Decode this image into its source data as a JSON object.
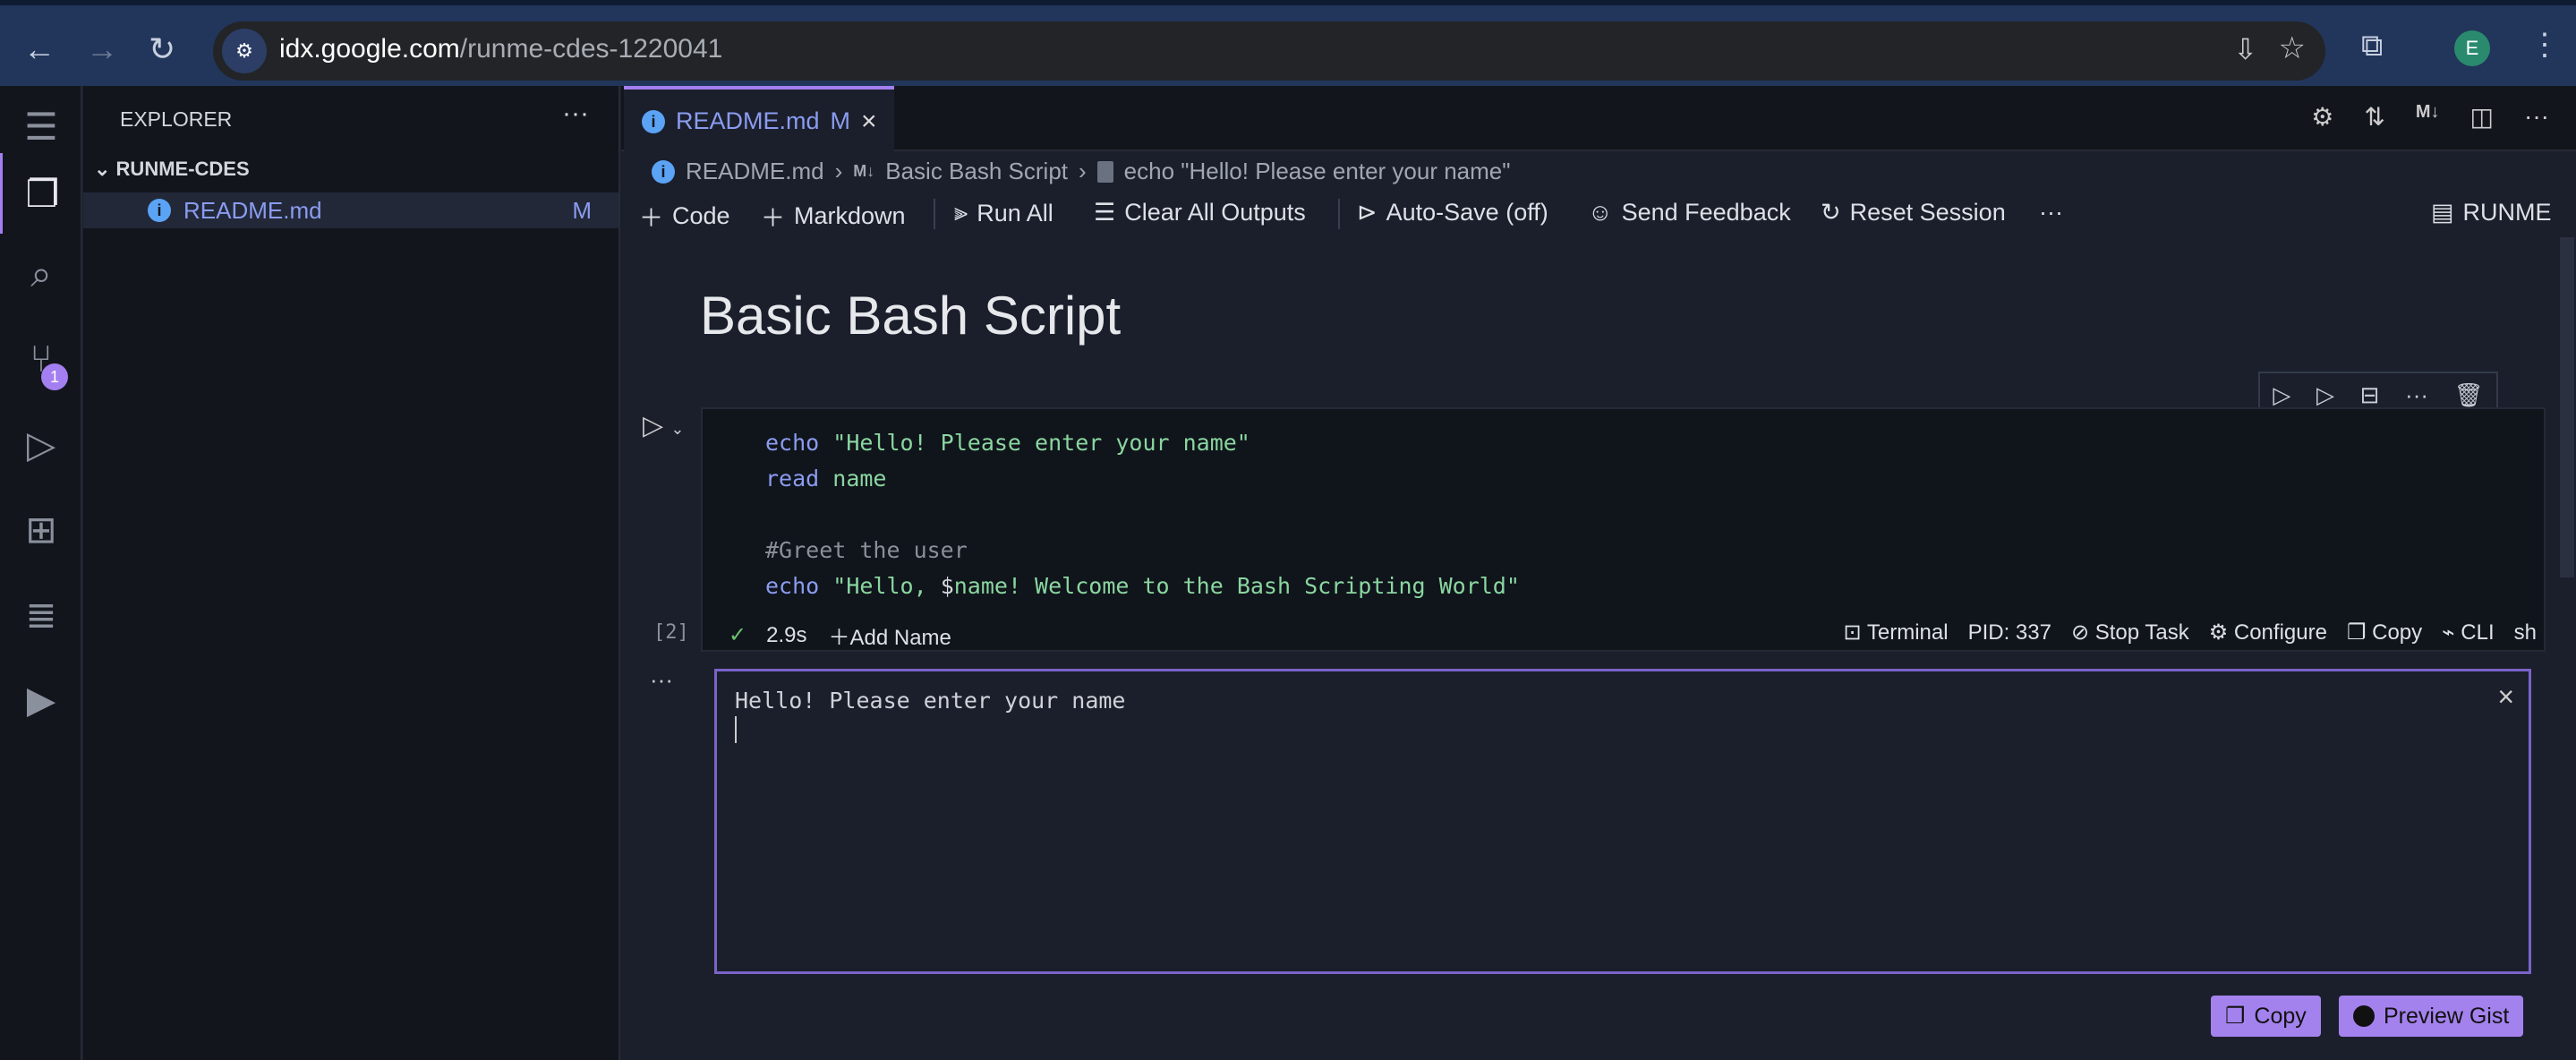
{
  "browser": {
    "url_host": "idx.google.com",
    "url_path": "/runme-cdes-1220041",
    "avatar": "E"
  },
  "sidebar": {
    "title": "EXPLORER",
    "folder": "RUNME-CDES",
    "files": [
      {
        "name": "README.md",
        "status": "M"
      }
    ]
  },
  "activity": {
    "scm_badge": "1"
  },
  "tab": {
    "label": "README.md",
    "status": "M"
  },
  "breadcrumb": [
    "README.md",
    "Basic Bash Script",
    "echo \"Hello! Please enter your name\""
  ],
  "toolbar": {
    "code": "Code",
    "markdown": "Markdown",
    "run_all": "Run All",
    "clear": "Clear All Outputs",
    "autosave": "Auto-Save (off)",
    "feedback": "Send Feedback",
    "reset": "Reset Session",
    "kernel": "RUNME"
  },
  "heading": "Basic Bash Script",
  "cell": {
    "lines": [
      [
        {
          "t": "echo",
          "c": "kw"
        },
        {
          "t": " \"Hello! Please enter your name\"",
          "c": "str"
        }
      ],
      [
        {
          "t": "read",
          "c": "kw"
        },
        {
          "t": " name",
          "c": "str"
        }
      ],
      [],
      [
        {
          "t": "#Greet the user",
          "c": "cm"
        }
      ],
      [
        {
          "t": "echo",
          "c": "kw"
        },
        {
          "t": " \"Hello, ",
          "c": "str"
        },
        {
          "t": "$",
          "c": "var"
        },
        {
          "t": "name! Welcome to the Bash Scripting World\"",
          "c": "str"
        }
      ]
    ],
    "exec_count": "[2]",
    "duration": "2.9s",
    "add_name": "Add Name",
    "terminal": "Terminal",
    "pid": "PID: 337",
    "stop": "Stop Task",
    "configure": "Configure",
    "copy": "Copy",
    "cli": "CLI",
    "lang": "sh"
  },
  "output": {
    "text": "Hello! Please enter your name",
    "copy": "Copy",
    "gist": "Preview Gist"
  },
  "colors": {
    "accent": "#a482ee",
    "keyword": "#8a9cf0",
    "string": "#8ad6a0"
  }
}
